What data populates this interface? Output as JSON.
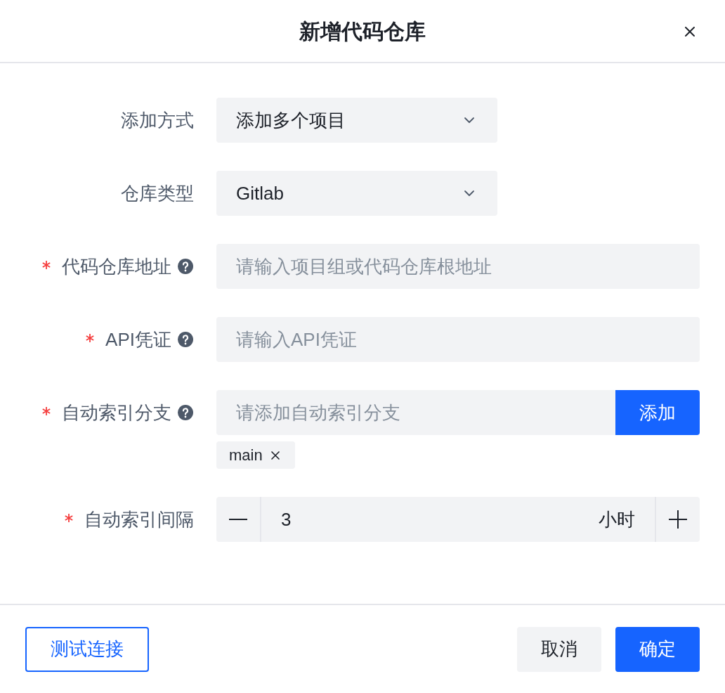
{
  "dialog": {
    "title": "新增代码仓库"
  },
  "fields": [
    {
      "kind": "select",
      "label": "添加方式",
      "required": false,
      "help": false,
      "value": "添加多个项目"
    },
    {
      "kind": "select",
      "label": "仓库类型",
      "required": false,
      "help": false,
      "value": "Gitlab"
    },
    {
      "kind": "input",
      "label": "代码仓库地址",
      "required": true,
      "help": true,
      "placeholder": "请输入项目组或代码仓库根地址"
    },
    {
      "kind": "input",
      "label": "API凭证",
      "required": true,
      "help": true,
      "placeholder": "请输入API凭证"
    },
    {
      "kind": "tags",
      "label": "自动索引分支",
      "required": true,
      "help": true,
      "placeholder": "请添加自动索引分支",
      "button": "添加",
      "tags": [
        "main"
      ]
    },
    {
      "kind": "number",
      "label": "自动索引间隔",
      "required": true,
      "help": false,
      "value": "3",
      "unit": "小时"
    }
  ],
  "footer": {
    "test_button": "测试连接",
    "cancel_button": "取消",
    "ok_button": "确定"
  }
}
